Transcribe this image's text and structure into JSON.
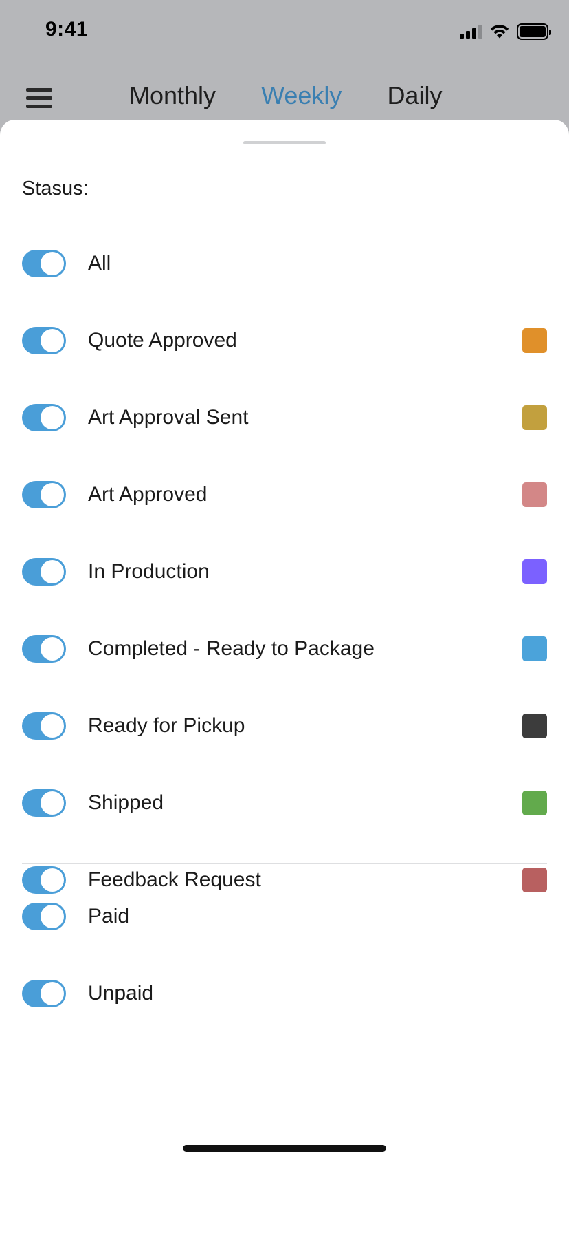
{
  "status_bar": {
    "time": "9:41"
  },
  "nav": {
    "tabs": [
      {
        "label": "Monthly",
        "active": false
      },
      {
        "label": "Weekly",
        "active": true
      },
      {
        "label": "Daily",
        "active": false
      }
    ]
  },
  "sheet": {
    "section_label": "Stasus:",
    "status_filters": [
      {
        "label": "All",
        "enabled": true,
        "color": null
      },
      {
        "label": "Quote Approved",
        "enabled": true,
        "color": "#e0902a"
      },
      {
        "label": "Art Approval Sent",
        "enabled": true,
        "color": "#c2a03e"
      },
      {
        "label": "Art Approved",
        "enabled": true,
        "color": "#d38787"
      },
      {
        "label": "In Production",
        "enabled": true,
        "color": "#7b61ff"
      },
      {
        "label": "Completed - Ready to Package",
        "enabled": true,
        "color": "#4ba3da"
      },
      {
        "label": "Ready for Pickup",
        "enabled": true,
        "color": "#3c3c3c"
      },
      {
        "label": "Shipped",
        "enabled": true,
        "color": "#62aa4c"
      },
      {
        "label": "Feedback Request",
        "enabled": true,
        "color": "#b86060"
      }
    ],
    "payment_filters": [
      {
        "label": "Paid",
        "enabled": true
      },
      {
        "label": "Unpaid",
        "enabled": true
      }
    ]
  },
  "colors": {
    "accent": "#4a9ed8",
    "active_tab": "#3a7fb1"
  }
}
